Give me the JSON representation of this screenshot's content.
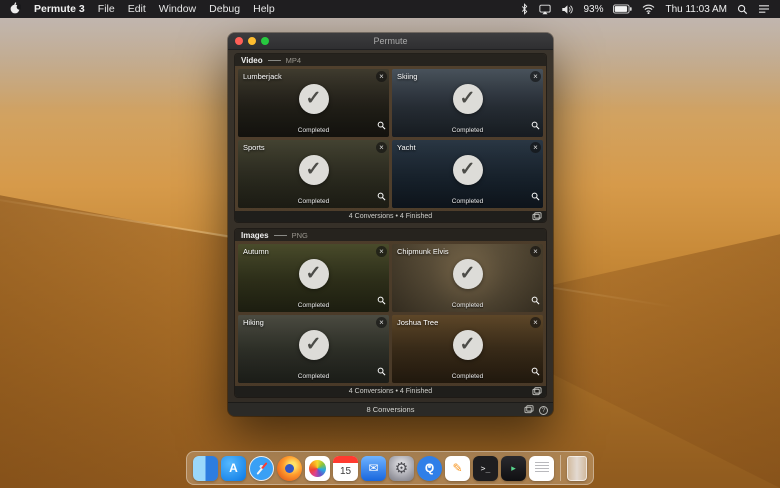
{
  "colors": {
    "accent": "#c98e3f",
    "menubar_bg": "#1b1b1d",
    "window_bg": "#34302a",
    "check_circle": "#dddcd8"
  },
  "menubar": {
    "app_name": "Permute 3",
    "menus": [
      "File",
      "Edit",
      "Window",
      "Debug",
      "Help"
    ],
    "status": {
      "battery_percent": "93%",
      "clock": "Thu 11:03 AM"
    }
  },
  "window": {
    "title": "Permute",
    "sections": [
      {
        "title": "Video",
        "format": "MP4",
        "footer": "4 Conversions • 4 Finished",
        "tiles": [
          {
            "title": "Lumberjack",
            "status": "Completed"
          },
          {
            "title": "Skiing",
            "status": "Completed"
          },
          {
            "title": "Sports",
            "status": "Completed"
          },
          {
            "title": "Yacht",
            "status": "Completed"
          }
        ]
      },
      {
        "title": "Images",
        "format": "PNG",
        "footer": "4 Conversions • 4 Finished",
        "tiles": [
          {
            "title": "Autumn",
            "status": "Completed"
          },
          {
            "title": "Chipmunk Elvis",
            "status": "Completed"
          },
          {
            "title": "Hiking",
            "status": "Completed"
          },
          {
            "title": "Joshua Tree",
            "status": "Completed"
          }
        ]
      }
    ],
    "statusbar": {
      "label": "8 Conversions",
      "help_label": "?"
    }
  },
  "dock": {
    "calendar_day": "15",
    "items": [
      "finder",
      "app-store",
      "safari",
      "firefox",
      "photos",
      "calendar",
      "mail",
      "system-preferences",
      "quicktime",
      "pages",
      "terminal",
      "dark-app",
      "textedit",
      "trash"
    ]
  }
}
